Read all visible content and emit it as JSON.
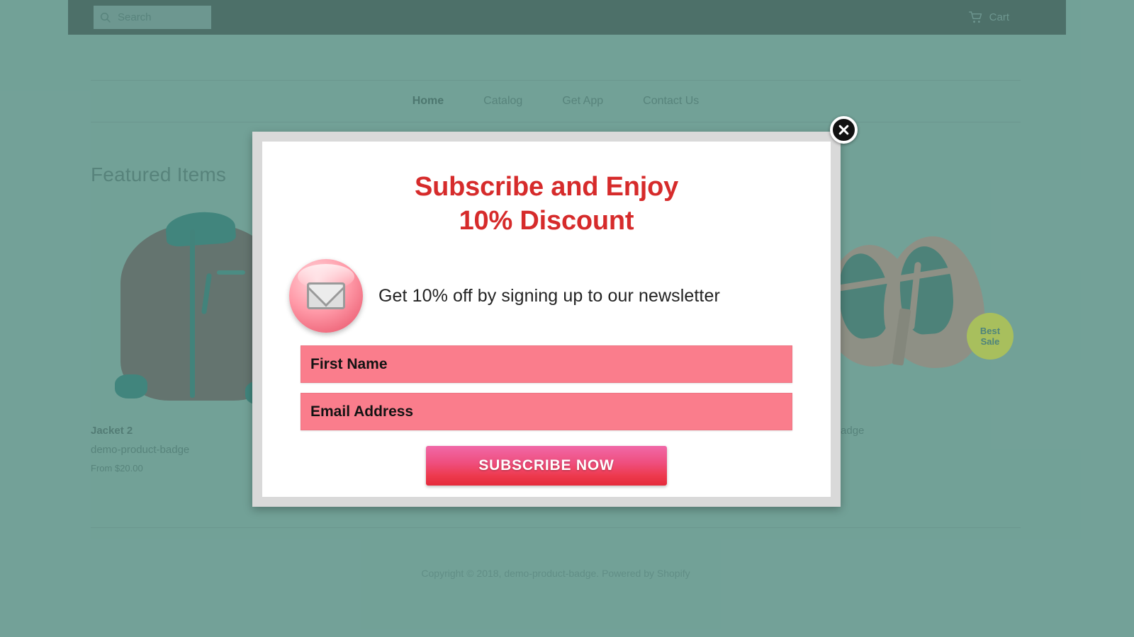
{
  "header": {
    "search": {
      "placeholder": "Search",
      "value": "",
      "icon": "search-icon"
    },
    "cart": {
      "label": "Cart",
      "icon": "cart-icon"
    }
  },
  "nav": {
    "items": [
      {
        "label": "Home",
        "active": true
      },
      {
        "label": "Catalog",
        "active": false
      },
      {
        "label": "Get App",
        "active": false
      },
      {
        "label": "Contact Us",
        "active": false
      }
    ]
  },
  "main": {
    "section_title": "Featured Items",
    "products": [
      {
        "title": "Jacket 2",
        "vendor": "demo-product-badge",
        "price": "From $20.00",
        "badge": ""
      },
      {
        "title": "",
        "vendor": "",
        "price": "",
        "badge": ""
      },
      {
        "title": "",
        "vendor": "",
        "price": "",
        "badge": ""
      },
      {
        "title": "",
        "vendor": "oduct-badge",
        "price": "",
        "badge_line1": "Best",
        "badge_line2": "Sale"
      }
    ]
  },
  "footer": {
    "copyright": "Copyright © 2018, demo-product-badge. Powered by Shopify"
  },
  "modal": {
    "heading_line1": "Subscribe and Enjoy",
    "heading_line2": "10% Discount",
    "pitch": "Get 10% off by signing up to our newsletter",
    "mail_icon": "envelope-icon",
    "first_name": {
      "placeholder": "First Name",
      "value": ""
    },
    "email": {
      "placeholder": "Email Address",
      "value": ""
    },
    "submit_label": "SUBSCRIBE NOW",
    "close_icon": "close-icon"
  },
  "colors": {
    "page_bg": "#649a8f",
    "header_bg": "#2e534d",
    "heading_red": "#d62b2b",
    "field_pink": "#fa7d8c",
    "button_from": "#f069a8",
    "button_to": "#e52a3b",
    "badge_green": "#b1c43c"
  }
}
